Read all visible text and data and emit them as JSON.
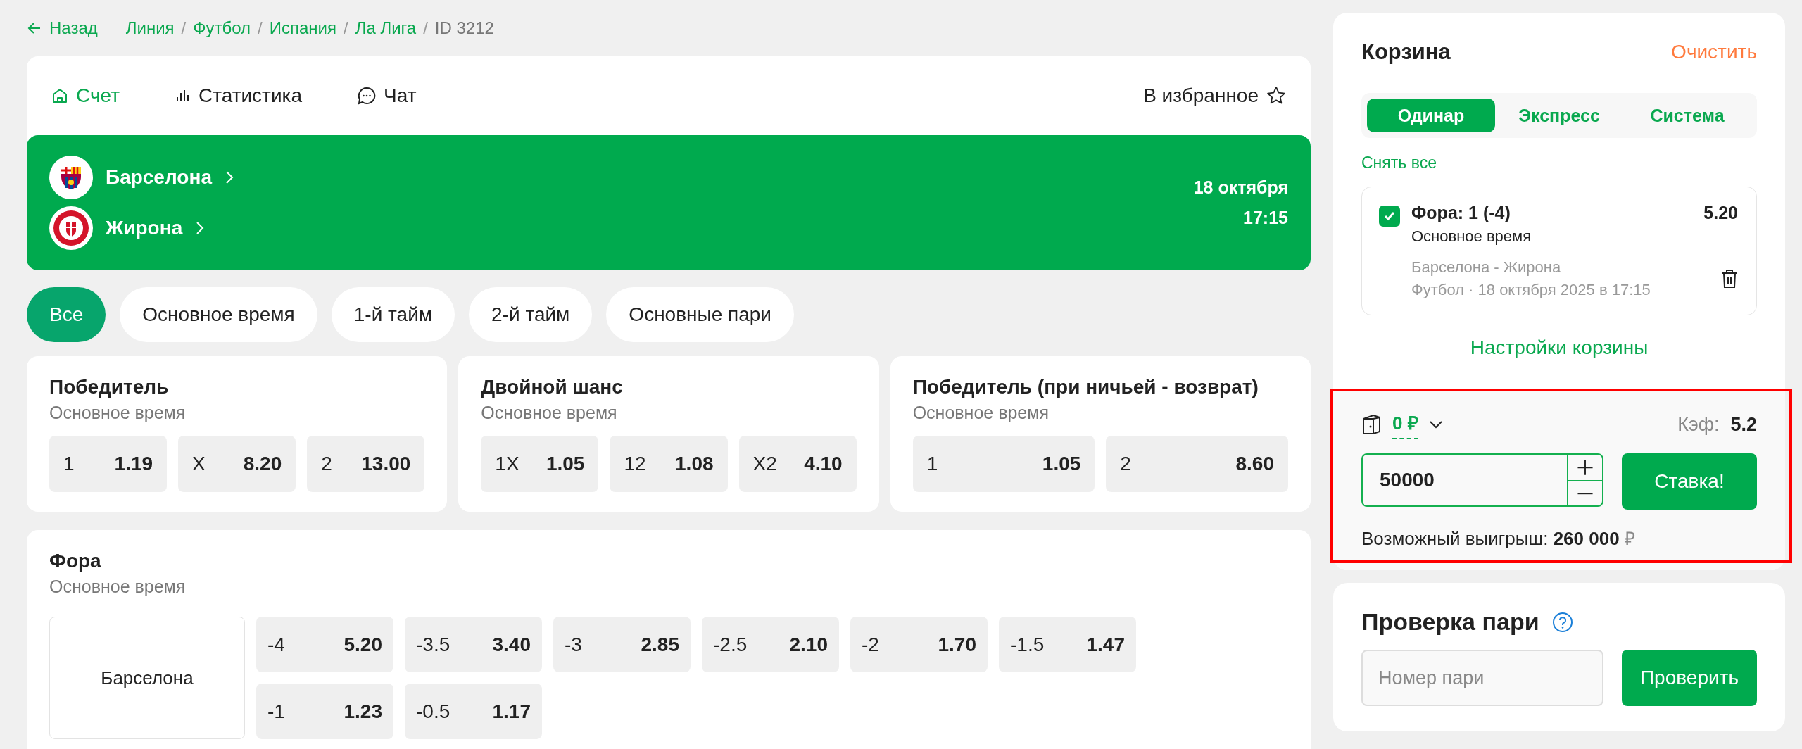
{
  "back_link": "Назад",
  "breadcrumb_separator": "/",
  "breadcrumbs": [
    {
      "label": "Линия",
      "current": false
    },
    {
      "label": "Футбол",
      "current": false
    },
    {
      "label": "Испания",
      "current": false
    },
    {
      "label": "Ла Лига",
      "current": false
    },
    {
      "label": "ID 3212",
      "current": true
    }
  ],
  "match_tabs": [
    {
      "label": "Счет",
      "kind": "home",
      "selected": true
    },
    {
      "label": "Статистика",
      "kind": "stats",
      "selected": false
    },
    {
      "label": "Чат",
      "kind": "chat",
      "selected": false
    }
  ],
  "favorite": "В избранное",
  "teams": [
    {
      "name": "Барселона",
      "kind": "barca"
    },
    {
      "name": "Жирона",
      "kind": "girona"
    }
  ],
  "date": "18 октября",
  "time": "17:15",
  "filters": [
    {
      "label": "Все",
      "selected": true
    },
    {
      "label": "Основное время",
      "selected": false
    },
    {
      "label": "1-й тайм",
      "selected": false
    },
    {
      "label": "2-й тайм",
      "selected": false
    },
    {
      "label": "Основные пари",
      "selected": false
    }
  ],
  "markets": [
    {
      "title": "Победитель",
      "period": "Основное время",
      "outcomes": [
        {
          "label": "1",
          "odds": "1.19"
        },
        {
          "label": "X",
          "odds": "8.20"
        },
        {
          "label": "2",
          "odds": "13.00"
        }
      ]
    },
    {
      "title": "Двойной шанс",
      "period": "Основное время",
      "outcomes": [
        {
          "label": "1X",
          "odds": "1.05"
        },
        {
          "label": "12",
          "odds": "1.08"
        },
        {
          "label": "X2",
          "odds": "4.10"
        }
      ]
    },
    {
      "title": "Победитель (при ничьей - возврат)",
      "period": "Основное время",
      "outcomes": [
        {
          "label": "1",
          "odds": "1.05"
        },
        {
          "label": "2",
          "odds": "8.60"
        }
      ]
    }
  ],
  "handicap": {
    "title": "Фора",
    "period": "Основное время",
    "rows": [
      {
        "team": "Барселона",
        "outcomes": [
          {
            "label": "-4",
            "odds": "5.20"
          },
          {
            "label": "-3.5",
            "odds": "3.40"
          },
          {
            "label": "-3",
            "odds": "2.85"
          },
          {
            "label": "-2.5",
            "odds": "2.10"
          },
          {
            "label": "-2",
            "odds": "1.70"
          },
          {
            "label": "-1.5",
            "odds": "1.47"
          },
          {
            "label": "-1",
            "odds": "1.23"
          },
          {
            "label": "-0.5",
            "odds": "1.17"
          }
        ]
      }
    ]
  },
  "cart": {
    "title": "Корзина",
    "clear": "Очистить",
    "modes": [
      {
        "label": "Одинар",
        "selected": true
      },
      {
        "label": "Экспресс",
        "selected": false
      },
      {
        "label": "Система",
        "selected": false
      }
    ],
    "remove_all": "Снять все",
    "bets": [
      {
        "checked": true,
        "title": "Фора: 1 (-4)",
        "period": "Основное время",
        "odds": "5.20",
        "match": "Барселона - Жирона",
        "details": "Футбол · 18 октября 2025 в 17:15"
      }
    ],
    "settings": "Настройки корзины"
  },
  "stake": {
    "balance": "0 ₽",
    "coef_label": "Кэф:",
    "coef": "5.2",
    "amount": "50000",
    "submit": "Ставка!",
    "win_label": "Возможный выигрыш:",
    "win_value": "260 000",
    "currency": "₽"
  },
  "check": {
    "title": "Проверка пари",
    "placeholder": "Номер пари",
    "submit": "Проверить"
  }
}
